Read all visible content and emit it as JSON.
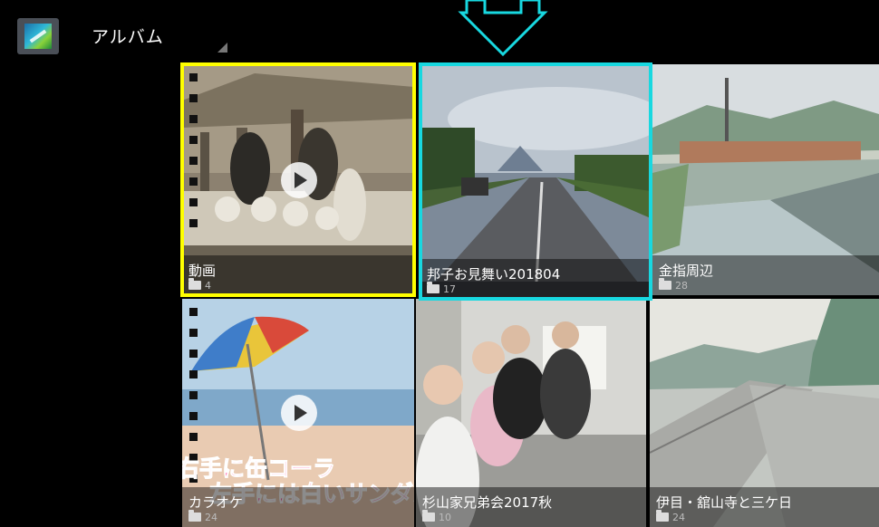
{
  "header": {
    "title": "アルバム",
    "app_icon": "gallery-app-icon",
    "menu_indicator": "dropdown-triangle-icon"
  },
  "annotations": {
    "arrow_color": "#18d8e0",
    "yellow_highlight": "#ffff00",
    "cyan_highlight": "#18d8e0"
  },
  "albums": [
    {
      "name": "動画",
      "count": "4",
      "video": true
    },
    {
      "name": "邦子お見舞い201804",
      "count": "17",
      "video": false
    },
    {
      "name": "金指周辺",
      "count": "28",
      "video": false
    },
    {
      "name": "カラオケ",
      "count": "24",
      "video": true
    },
    {
      "name": "杉山家兄弟会2017秋",
      "count": "10",
      "video": false
    },
    {
      "name": "伊目・舘山寺と三ケ日",
      "count": "24",
      "video": false
    }
  ],
  "karaoke_lyrics": [
    "右手に缶コーラ",
    "左手には白いサンダル"
  ]
}
